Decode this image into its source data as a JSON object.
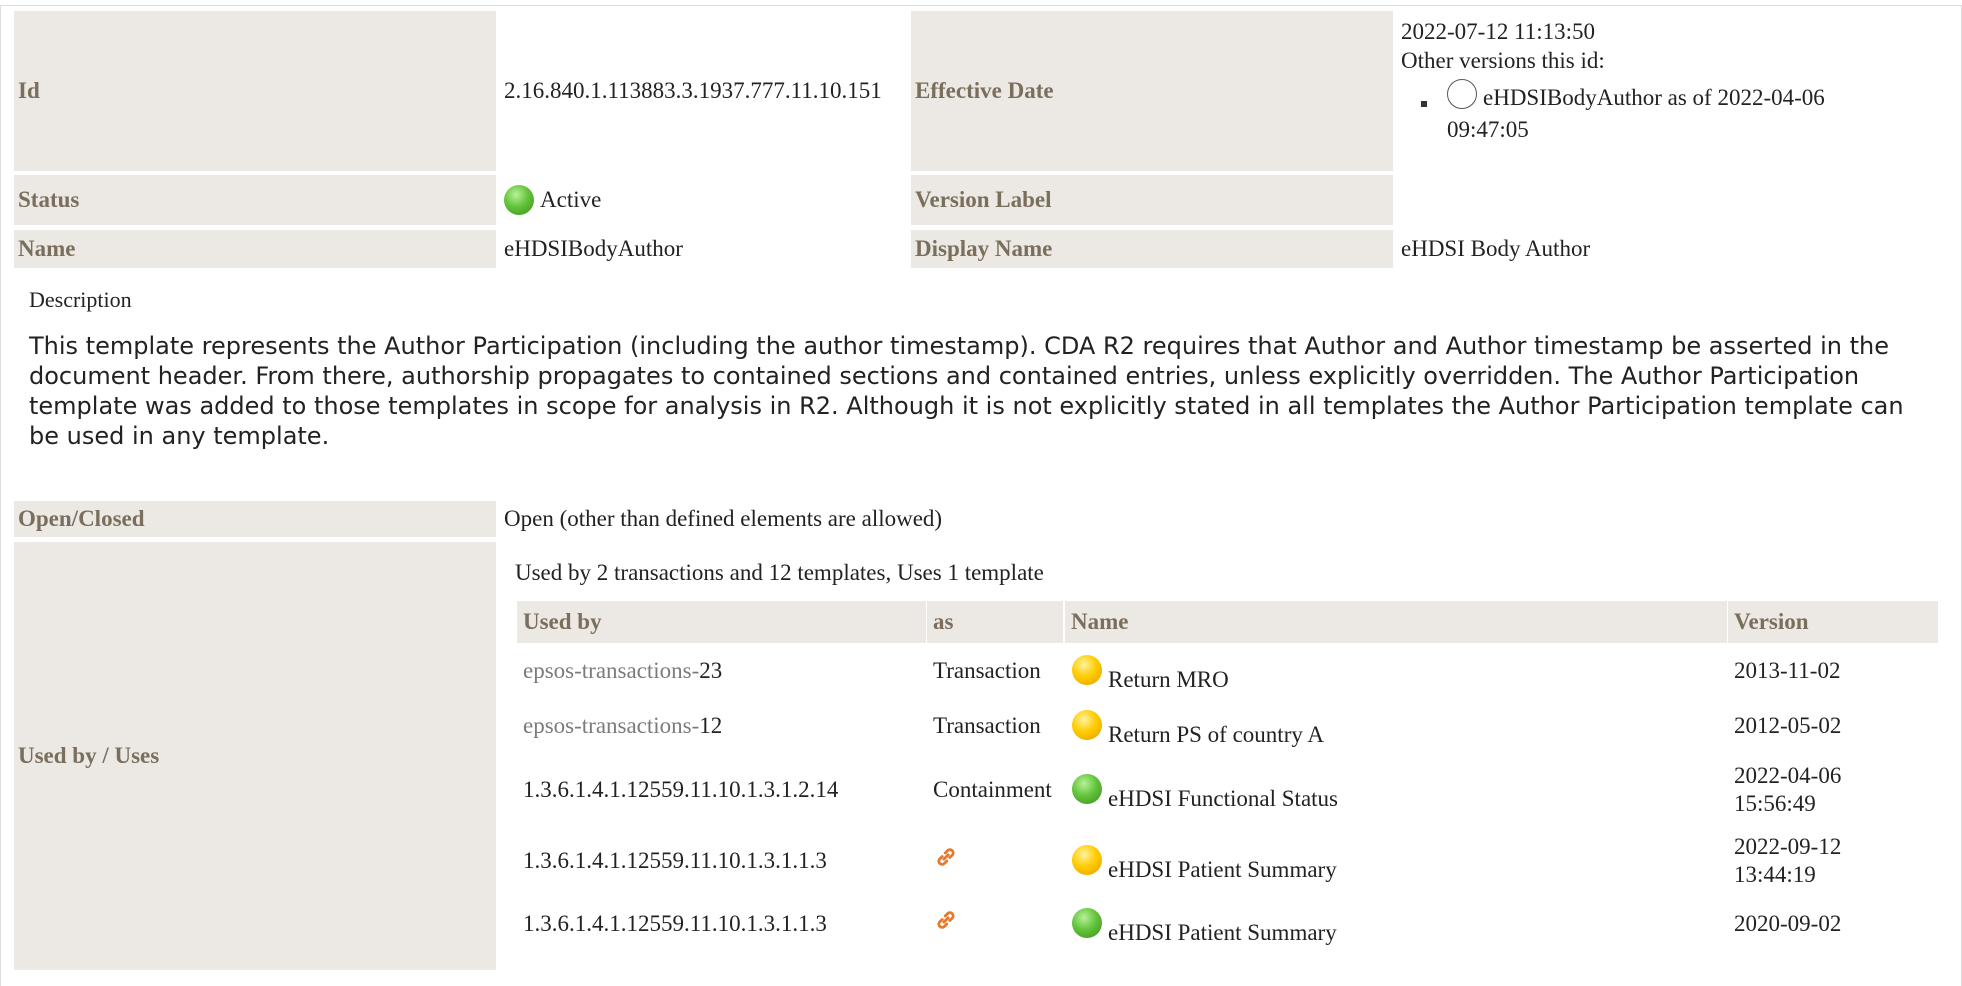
{
  "id": {
    "label": "Id",
    "value": "2.16.840.1.113883.3.1937.777.11.10.151"
  },
  "effective_date": {
    "label": "Effective Date",
    "value": "2022-07-12 11:13:50",
    "other_versions_label": "Other versions this id:",
    "other_version_line1": "eHDSIBodyAuthor as of 2022-04-06",
    "other_version_line2": "09:47:05"
  },
  "status": {
    "label": "Status",
    "value": "Active",
    "color": "#63c43a"
  },
  "version_label": {
    "label": "Version Label",
    "value": ""
  },
  "name": {
    "label": "Name",
    "value": "eHDSIBodyAuthor"
  },
  "display_name": {
    "label": "Display Name",
    "value": "eHDSI Body Author"
  },
  "description": {
    "heading": "Description",
    "text": "This template represents the Author Participation (including the author timestamp). CDA R2 requires that Author and Author timestamp be asserted in the document header. From there, authorship propagates to contained sections and contained entries, unless explicitly overridden. The Author Participation template was added to those templates in scope for analysis in R2. Although it is not explicitly stated in all templates the Author Participation template can be used in any template."
  },
  "open_closed": {
    "label": "Open/Closed",
    "value": "Open (other than defined elements are allowed)"
  },
  "used_by": {
    "label": "Used by / Uses",
    "summary": "Used by 2 transactions and 12 templates, Uses 1 template",
    "columns": [
      "Used by",
      "as",
      "Name",
      "Version"
    ],
    "rows": [
      {
        "prefix": "epsos-transactions-",
        "id": "23",
        "as": "Transaction",
        "as_icon": "",
        "status": "yellow",
        "name": "Return MRO",
        "version": "2013-11-02",
        "version2": ""
      },
      {
        "prefix": "epsos-transactions-",
        "id": "12",
        "as": "Transaction",
        "as_icon": "",
        "status": "yellow",
        "name": "Return PS of country A",
        "version": "2012-05-02",
        "version2": ""
      },
      {
        "prefix": "",
        "id": "1.3.6.1.4.1.12559.11.10.1.3.1.2.14",
        "as": "Containment",
        "as_icon": "",
        "status": "green",
        "name": "eHDSI Functional Status",
        "version": "2022-04-06",
        "version2": "15:56:49"
      },
      {
        "prefix": "",
        "id": "1.3.6.1.4.1.12559.11.10.1.3.1.1.3",
        "as": "",
        "as_icon": "link-icon",
        "status": "yellow",
        "name": "eHDSI Patient Summary",
        "version": "2022-09-12",
        "version2": "13:44:19"
      },
      {
        "prefix": "",
        "id": "1.3.6.1.4.1.12559.11.10.1.3.1.1.3",
        "as": "",
        "as_icon": "link-icon",
        "status": "green",
        "name": "eHDSI Patient Summary",
        "version": "2020-09-02",
        "version2": ""
      }
    ]
  },
  "colors": {
    "label_bg": "#ece9e4",
    "label_text": "#7a6e5d",
    "link_orange": "#e8782a"
  }
}
